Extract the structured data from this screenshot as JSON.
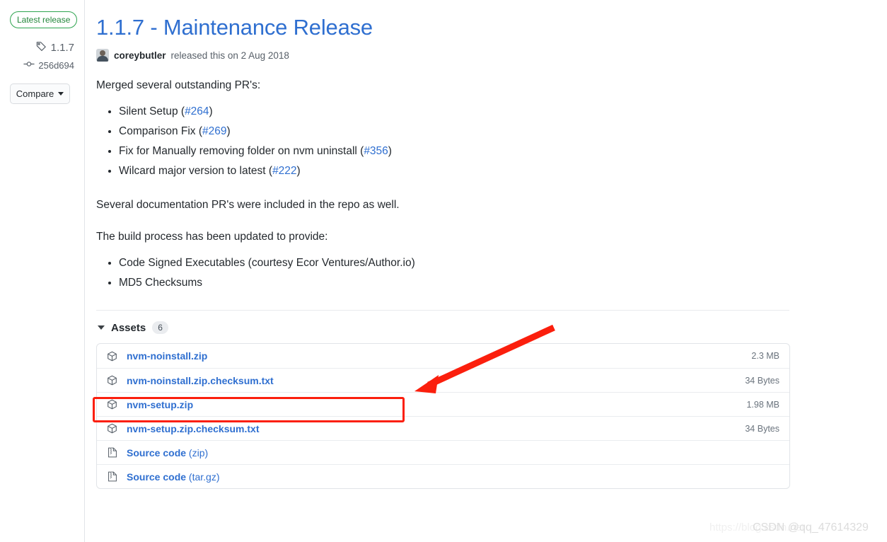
{
  "sidebar": {
    "latest_badge": "Latest release",
    "tag_icon": "tag-icon",
    "tag": "1.1.7",
    "commit_icon": "commit-icon",
    "commit": "256d694",
    "compare_label": "Compare",
    "compare_caret_icon": "chevron-down-icon"
  },
  "release": {
    "title": "1.1.7 - Maintenance Release",
    "author": "coreybutler",
    "byline_rest": "released this on 2 Aug 2018",
    "avatar_icon": "avatar"
  },
  "body": {
    "intro": "Merged several outstanding PR's:",
    "pr_list": [
      {
        "text": "Silent Setup",
        "ref": "#264"
      },
      {
        "text": "Comparison Fix",
        "ref": "#269"
      },
      {
        "text": "Fix for Manually removing folder on nvm uninstall",
        "ref": "#356"
      },
      {
        "text": "Wilcard major version to latest",
        "ref": "#222"
      }
    ],
    "docs_note": "Several documentation PR's were included in the repo as well.",
    "build_note": "The build process has been updated to provide:",
    "build_list": [
      "Code Signed Executables (courtesy Ecor Ventures/Author.io)",
      "MD5 Checksums"
    ]
  },
  "assets": {
    "caret_icon": "triangle-down-icon",
    "label": "Assets",
    "count": "6",
    "rows": [
      {
        "icon": "package-icon",
        "name": "nvm-noinstall.zip",
        "format": "",
        "size": "2.3 MB"
      },
      {
        "icon": "package-icon",
        "name": "nvm-noinstall.zip.checksum.txt",
        "format": "",
        "size": "34 Bytes"
      },
      {
        "icon": "package-icon",
        "name": "nvm-setup.zip",
        "format": "",
        "size": "1.98 MB"
      },
      {
        "icon": "package-icon",
        "name": "nvm-setup.zip.checksum.txt",
        "format": "",
        "size": "34 Bytes"
      },
      {
        "icon": "file-zip-icon",
        "name": "Source code",
        "format": "(zip)",
        "size": ""
      },
      {
        "icon": "file-zip-icon",
        "name": "Source code",
        "format": "(tar.gz)",
        "size": ""
      }
    ]
  },
  "annotations": {
    "highlight_color": "#fb1f0d",
    "arrow_color": "#fb1f0d",
    "arrow_from": "783,463",
    "arrow_to": "587,553"
  },
  "watermarks": {
    "url": "https://blog.csdn.net",
    "csdn": "CSDN @qq_47614329"
  },
  "colors": {
    "link": "#2f6fd0",
    "text": "#24292e",
    "muted": "#586069",
    "badge_green": "#22863a",
    "border": "#e1e4e8"
  }
}
